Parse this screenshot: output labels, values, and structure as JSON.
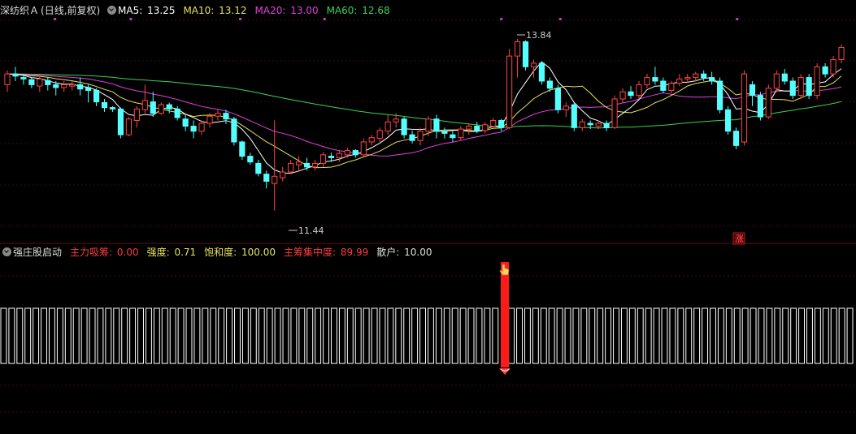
{
  "main_chart": {
    "stock_name": "深纺织Ａ",
    "period": "(日线,前复权)",
    "ma5": {
      "label": "MA5: ",
      "value": "13.25",
      "color": "#ffffff"
    },
    "ma10": {
      "label": "MA10: ",
      "value": "13.12",
      "color": "#e6e35a"
    },
    "ma20": {
      "label": "MA20: ",
      "value": "13.00",
      "color": "#e040e0"
    },
    "ma60": {
      "label": "MA60: ",
      "value": "12.68",
      "color": "#39d353"
    },
    "high_marker": "13.84",
    "low_marker": "11.44",
    "zhang_badge": "涨",
    "up_color": "#ff4444",
    "down_color": "#54ffff"
  },
  "chart_data": {
    "type": "candlestick",
    "y_range": [
      11.3,
      14.1
    ],
    "high": 13.84,
    "low": 11.44,
    "candles": [
      [
        13.2,
        13.35,
        13.4,
        13.1
      ],
      [
        13.35,
        13.32,
        13.45,
        13.25
      ],
      [
        13.3,
        13.28,
        13.35,
        13.2
      ],
      [
        13.27,
        13.2,
        13.3,
        13.15
      ],
      [
        13.18,
        13.28,
        13.32,
        13.1
      ],
      [
        13.26,
        13.2,
        13.3,
        13.12
      ],
      [
        13.2,
        13.16,
        13.25,
        13.05
      ],
      [
        13.16,
        13.2,
        13.25,
        13.1
      ],
      [
        13.18,
        13.2,
        13.25,
        13.12
      ],
      [
        13.2,
        13.14,
        13.3,
        13.05
      ],
      [
        13.16,
        13.12,
        13.2,
        12.95
      ],
      [
        13.12,
        12.96,
        13.15,
        12.9
      ],
      [
        12.95,
        12.88,
        13.0,
        12.82
      ],
      [
        12.88,
        12.86,
        12.9,
        12.82
      ],
      [
        12.86,
        12.5,
        12.88,
        12.45
      ],
      [
        12.5,
        12.72,
        12.75,
        12.48
      ],
      [
        12.7,
        12.86,
        12.9,
        12.6
      ],
      [
        12.85,
        12.98,
        13.2,
        12.8
      ],
      [
        12.96,
        12.8,
        13.1,
        12.75
      ],
      [
        12.8,
        12.92,
        12.95,
        12.78
      ],
      [
        12.92,
        12.86,
        12.95,
        12.8
      ],
      [
        12.86,
        12.74,
        12.9,
        12.7
      ],
      [
        12.72,
        12.62,
        12.78,
        12.55
      ],
      [
        12.62,
        12.55,
        12.7,
        12.45
      ],
      [
        12.55,
        12.66,
        12.7,
        12.5
      ],
      [
        12.66,
        12.76,
        12.8,
        12.6
      ],
      [
        12.76,
        12.8,
        12.85,
        12.7
      ],
      [
        12.8,
        12.72,
        12.85,
        12.65
      ],
      [
        12.72,
        12.4,
        12.75,
        12.35
      ],
      [
        12.4,
        12.2,
        12.42,
        12.15
      ],
      [
        12.2,
        12.12,
        12.25,
        12.08
      ],
      [
        12.1,
        11.96,
        12.15,
        11.92
      ],
      [
        11.95,
        11.85,
        12.0,
        11.75
      ],
      [
        11.82,
        11.92,
        12.7,
        11.44
      ],
      [
        11.9,
        11.98,
        12.05,
        11.85
      ],
      [
        11.98,
        12.1,
        12.15,
        11.95
      ],
      [
        12.08,
        12.12,
        12.2,
        12.0
      ],
      [
        12.1,
        12.05,
        12.18,
        12.0
      ],
      [
        12.05,
        12.1,
        12.15,
        12.0
      ],
      [
        12.1,
        12.22,
        12.26,
        12.05
      ],
      [
        12.2,
        12.18,
        12.25,
        12.12
      ],
      [
        12.18,
        12.24,
        12.28,
        12.12
      ],
      [
        12.22,
        12.28,
        12.32,
        12.18
      ],
      [
        12.28,
        12.22,
        12.3,
        12.18
      ],
      [
        12.22,
        12.4,
        12.45,
        12.2
      ],
      [
        12.4,
        12.46,
        12.5,
        12.35
      ],
      [
        12.45,
        12.56,
        12.6,
        12.4
      ],
      [
        12.55,
        12.68,
        12.78,
        12.5
      ],
      [
        12.68,
        12.72,
        12.8,
        12.6
      ],
      [
        12.72,
        12.5,
        12.75,
        12.45
      ],
      [
        12.5,
        12.42,
        12.56,
        12.38
      ],
      [
        12.42,
        12.55,
        12.6,
        12.35
      ],
      [
        12.55,
        12.72,
        12.76,
        12.48
      ],
      [
        12.72,
        12.55,
        12.78,
        12.45
      ],
      [
        12.55,
        12.52,
        12.6,
        12.45
      ],
      [
        12.5,
        12.46,
        12.55,
        12.4
      ],
      [
        12.46,
        12.58,
        12.62,
        12.42
      ],
      [
        12.58,
        12.62,
        12.66,
        12.5
      ],
      [
        12.62,
        12.56,
        12.68,
        12.52
      ],
      [
        12.56,
        12.64,
        12.68,
        12.52
      ],
      [
        12.62,
        12.7,
        12.74,
        12.6
      ],
      [
        12.7,
        12.6,
        12.72,
        12.55
      ],
      [
        12.6,
        13.6,
        13.7,
        12.58
      ],
      [
        13.6,
        13.8,
        13.84,
        13.3
      ],
      [
        13.8,
        13.45,
        13.82,
        13.4
      ],
      [
        13.45,
        13.5,
        13.55,
        13.3
      ],
      [
        13.5,
        13.25,
        13.52,
        13.2
      ],
      [
        13.25,
        13.15,
        13.3,
        13.1
      ],
      [
        13.15,
        12.85,
        13.2,
        12.8
      ],
      [
        12.85,
        12.9,
        12.95,
        12.75
      ],
      [
        12.92,
        12.6,
        12.95,
        12.55
      ],
      [
        12.6,
        12.68,
        12.72,
        12.55
      ],
      [
        12.66,
        12.64,
        12.7,
        12.58
      ],
      [
        12.62,
        12.66,
        12.7,
        12.58
      ],
      [
        12.66,
        12.6,
        12.7,
        12.55
      ],
      [
        12.6,
        13.0,
        13.05,
        12.58
      ],
      [
        13.0,
        13.1,
        13.15,
        12.95
      ],
      [
        13.1,
        13.05,
        13.18,
        13.0
      ],
      [
        13.05,
        13.2,
        13.25,
        13.0
      ],
      [
        13.2,
        13.3,
        13.35,
        13.15
      ],
      [
        13.3,
        13.25,
        13.45,
        13.2
      ],
      [
        13.25,
        13.12,
        13.3,
        13.08
      ],
      [
        13.12,
        13.22,
        13.25,
        13.08
      ],
      [
        13.22,
        13.28,
        13.35,
        13.18
      ],
      [
        13.28,
        13.3,
        13.35,
        13.22
      ],
      [
        13.3,
        13.35,
        13.38,
        13.25
      ],
      [
        13.35,
        13.3,
        13.4,
        13.25
      ],
      [
        13.3,
        13.25,
        13.38,
        13.2
      ],
      [
        13.25,
        12.85,
        13.3,
        12.8
      ],
      [
        12.85,
        12.55,
        12.9,
        12.5
      ],
      [
        12.55,
        12.35,
        12.6,
        12.3
      ],
      [
        12.4,
        13.35,
        13.4,
        12.35
      ],
      [
        13.2,
        13.05,
        13.25,
        12.9
      ],
      [
        13.05,
        12.75,
        13.1,
        12.7
      ],
      [
        12.75,
        13.15,
        13.2,
        12.72
      ],
      [
        13.15,
        13.35,
        13.4,
        13.1
      ],
      [
        13.35,
        13.25,
        13.42,
        13.2
      ],
      [
        13.25,
        13.05,
        13.3,
        13.0
      ],
      [
        13.05,
        13.3,
        13.35,
        13.0
      ],
      [
        13.3,
        13.05,
        13.35,
        13.0
      ],
      [
        13.05,
        13.45,
        13.5,
        13.0
      ],
      [
        13.45,
        13.35,
        13.5,
        13.3
      ],
      [
        13.35,
        13.55,
        13.6,
        13.3
      ],
      [
        13.55,
        13.72,
        13.76,
        13.5
      ]
    ]
  },
  "indicator_panel": {
    "name": "强庄股启动",
    "fields": [
      {
        "label": "主力吸筹: ",
        "value": "0.00",
        "color": "#ff3b3b"
      },
      {
        "label": "强度: ",
        "value": "0.71",
        "color": "#e6e35a"
      },
      {
        "label": "饱和度: ",
        "value": "100.00",
        "color": "#e6e35a"
      },
      {
        "label": "主筹集中度: ",
        "value": "89.99",
        "color": "#ff3b3b"
      },
      {
        "label": "散户: ",
        "value": "10.00",
        "color": "#dddddd"
      }
    ],
    "signal_bar_index": 62,
    "bar_count": 106
  },
  "colors": {
    "background": "#000000",
    "grid": "#3a0d0d",
    "divider": "#5a1010",
    "marker_purple": "#c040c0",
    "signal_red": "#ff1a1a"
  }
}
